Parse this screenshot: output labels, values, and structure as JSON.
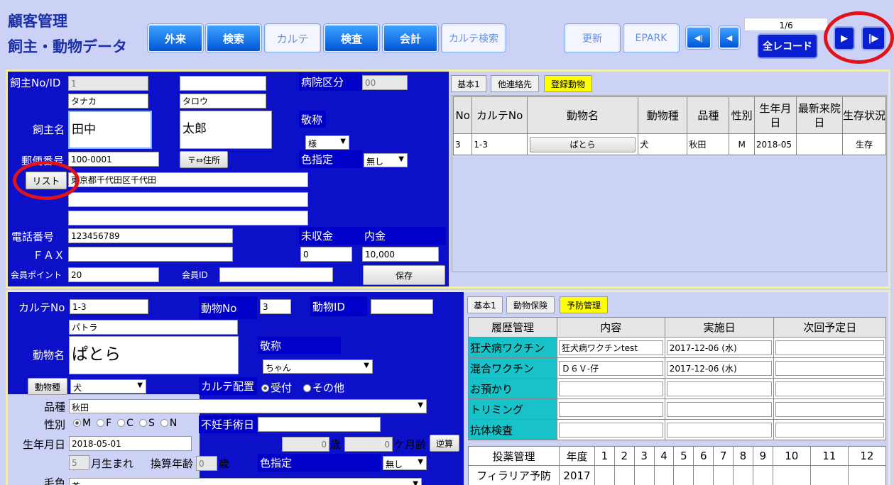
{
  "header": {
    "title1": "顧客管理",
    "title2": "飼主・動物データ",
    "record_counter": "1/6",
    "all_records": "全レコード"
  },
  "nav": {
    "outpatient": "外来",
    "search": "検索",
    "karte": "カルテ",
    "exam": "検査",
    "billing": "会計",
    "karte_search": "カルテ検索",
    "update": "更新",
    "epark": "EPARK"
  },
  "icons": {
    "first": "◀|",
    "prev": "◀",
    "next": "▶",
    "last": "|▶"
  },
  "owner": {
    "no_label": "飼主No/ID",
    "no_value": "1",
    "id_value": "",
    "hospital_label": "病院区分",
    "hospital_value": "00",
    "kana_last": "タナカ",
    "kana_first": "タロウ",
    "name_label": "飼主名",
    "last_name": "田中",
    "first_name": "太郎",
    "honorific_label": "敬称",
    "honorific_value": "様",
    "zip_label": "郵便番号",
    "zip_value": "100-0001",
    "zip_btn": "〒⇔住所",
    "color_label": "色指定",
    "color_value": "無し",
    "list_btn": "リスト",
    "address1": "東京都千代田区千代田",
    "address2": "",
    "address3": "",
    "phone_label": "電話番号",
    "phone_value": "123456789",
    "unpaid_label": "未収金",
    "unpaid_value": "0",
    "deposit_label": "内金",
    "deposit_value": "10,000",
    "fax_label": "ＦＡＸ",
    "fax_value": "",
    "points_label": "会員ポイント",
    "points_value": "20",
    "member_id_label": "会員ID",
    "member_id_value": "",
    "save_btn": "保存"
  },
  "owner_tabs": [
    "基本1",
    "他連絡先",
    "登録動物"
  ],
  "animals_table": {
    "headers": [
      "No",
      "カルテNo",
      "動物名",
      "動物種",
      "品種",
      "性別",
      "生年月日",
      "最新来院日",
      "生存状況"
    ],
    "rows": [
      [
        "3",
        "1-3",
        "ぱとら",
        "犬",
        "秋田",
        "M",
        "2018-05",
        "",
        "生存"
      ]
    ]
  },
  "animal": {
    "karte_no_label": "カルテNo",
    "karte_no_value": "1-3",
    "animal_no_label": "動物No",
    "animal_no_value": "3",
    "animal_id_label": "動物ID",
    "animal_id_value": "",
    "kana": "パトラ",
    "name_label": "動物名",
    "name_value": "ぱとら",
    "honorific_label": "敬称",
    "honorific_value": "ちゃん",
    "species_btn": "動物種",
    "species_value": "犬",
    "placement_label": "カルテ配置",
    "placement_opt1": "受付",
    "placement_opt2": "その他",
    "breed_label": "品種",
    "breed_value": "秋田",
    "sex_label": "性別",
    "sex_m": "M",
    "sex_f": "F",
    "sex_c": "C",
    "sex_s": "S",
    "sex_n": "N",
    "surgery_label": "不妊手術日",
    "surgery_value": "",
    "birth_label": "生年月日",
    "birth_value": "2018-05-01",
    "age_years": "0",
    "age_years_unit": "歳",
    "age_months": "0",
    "age_months_unit": "ケ月齢",
    "calc_btn": "逆算",
    "born_month": "5",
    "born_suffix": "月生まれ",
    "conv_label": "換算年齢",
    "conv_value": "0",
    "conv_unit": "歳",
    "color_label": "色指定",
    "color_value": "無し",
    "coat_label": "毛色",
    "coat_value": "茶"
  },
  "animal_tabs": [
    "基本1",
    "動物保険",
    "予防管理"
  ],
  "history_table": {
    "headers": [
      "履歴管理",
      "内容",
      "実施日",
      "次回予定日"
    ],
    "rows": [
      [
        "狂犬病ワクチン",
        "狂犬病ワクチンtest",
        "2017-12-06 (水)",
        ""
      ],
      [
        "混合ワクチン",
        "Ｄ６Ｖ-仔",
        "2017-12-06 (水)",
        ""
      ],
      [
        "お預かり",
        "",
        "",
        ""
      ],
      [
        "トリミング",
        "",
        "",
        ""
      ],
      [
        "抗体検査",
        "",
        "",
        ""
      ]
    ]
  },
  "medication_table": {
    "headers": [
      "投薬管理",
      "年度",
      "1",
      "2",
      "3",
      "4",
      "5",
      "6",
      "7",
      "8",
      "9",
      "10",
      "11",
      "12"
    ],
    "rows": [
      [
        "フィラリア予防",
        "2017",
        "",
        "",
        "",
        "",
        "",
        "",
        "",
        "",
        "",
        "",
        "",
        ""
      ]
    ]
  }
}
